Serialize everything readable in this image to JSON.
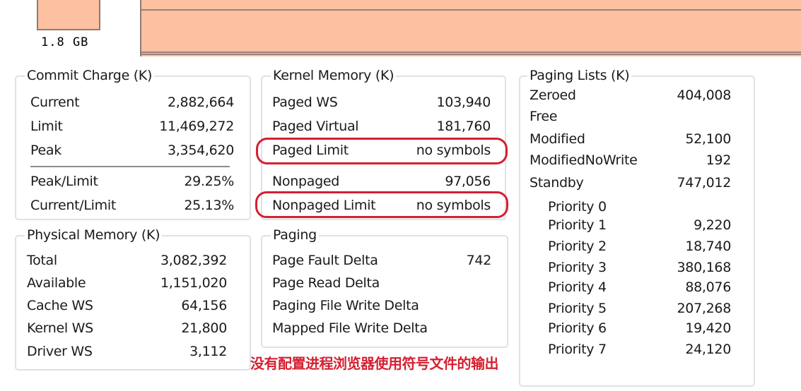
{
  "mini_graph": {
    "label": "1.8 GB"
  },
  "commit_charge": {
    "title": "Commit Charge (K)",
    "rows": [
      {
        "label": "Current",
        "value": "2,882,664"
      },
      {
        "label": "Limit",
        "value": "11,469,272"
      },
      {
        "label": "Peak",
        "value": "3,354,620"
      }
    ],
    "ratios": [
      {
        "label": "Peak/Limit",
        "value": "29.25%"
      },
      {
        "label": "Current/Limit",
        "value": "25.13%"
      }
    ]
  },
  "physical_memory": {
    "title": "Physical Memory (K)",
    "rows": [
      {
        "label": "Total",
        "value": "3,082,392"
      },
      {
        "label": "Available",
        "value": "1,151,020"
      },
      {
        "label": "Cache WS",
        "value": "64,156"
      },
      {
        "label": "Kernel WS",
        "value": "21,800"
      },
      {
        "label": "Driver WS",
        "value": "3,112"
      }
    ]
  },
  "kernel_memory": {
    "title": "Kernel Memory (K)",
    "rows": [
      {
        "label": "Paged WS",
        "value": "103,940"
      },
      {
        "label": "Paged Virtual",
        "value": "181,760"
      },
      {
        "label": "Paged Limit",
        "value": "no symbols"
      },
      {
        "label": "Nonpaged",
        "value": "97,056"
      },
      {
        "label": "Nonpaged Limit",
        "value": "no symbols"
      }
    ]
  },
  "paging": {
    "title": "Paging",
    "rows": [
      {
        "label": "Page Fault Delta",
        "value": "742"
      },
      {
        "label": "Page Read Delta",
        "value": ""
      },
      {
        "label": "Paging File Write Delta",
        "value": ""
      },
      {
        "label": "Mapped File Write Delta",
        "value": ""
      }
    ]
  },
  "paging_lists": {
    "title": "Paging Lists (K)",
    "rows": [
      {
        "label": "Zeroed",
        "value": "404,008"
      },
      {
        "label": "Free",
        "value": ""
      },
      {
        "label": "Modified",
        "value": "52,100"
      },
      {
        "label": "ModifiedNoWrite",
        "value": "192"
      },
      {
        "label": "Standby",
        "value": "747,012"
      }
    ],
    "priorities": [
      {
        "label": "Priority 0",
        "value": ""
      },
      {
        "label": "Priority 1",
        "value": "9,220"
      },
      {
        "label": "Priority 2",
        "value": "18,740"
      },
      {
        "label": "Priority 3",
        "value": "380,168"
      },
      {
        "label": "Priority 4",
        "value": "88,076"
      },
      {
        "label": "Priority 5",
        "value": "207,268"
      },
      {
        "label": "Priority 6",
        "value": "19,420"
      },
      {
        "label": "Priority 7",
        "value": "24,120"
      }
    ]
  },
  "annotation": {
    "text": "没有配置进程浏览器使用符号文件的输出",
    "color": "#d42030"
  },
  "colors": {
    "graph_fill": "#fdc0a0",
    "graph_line": "#9a8078",
    "highlight": "#d42030"
  }
}
